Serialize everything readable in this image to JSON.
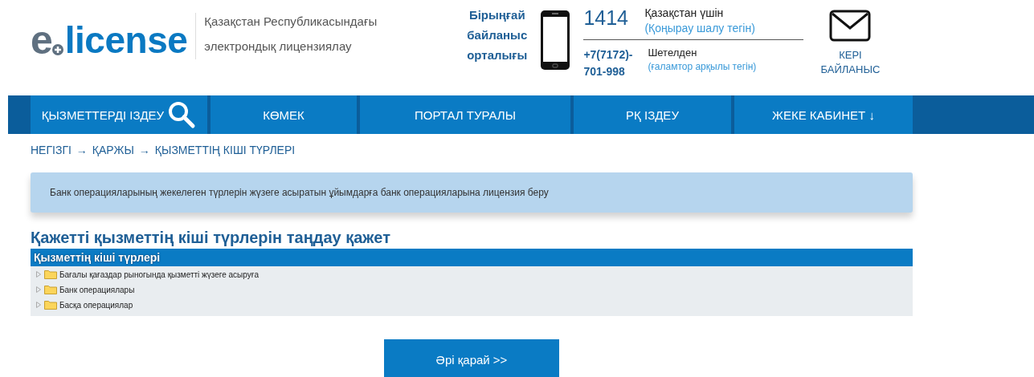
{
  "header": {
    "logo": {
      "letter": "e",
      "word": "license"
    },
    "tagline": [
      "Қазақстан Республикасындағы",
      "электрондық лицензиялау"
    ],
    "contact_center": [
      "Бірыңғай",
      "байланыс",
      "орталығы"
    ],
    "phones": [
      {
        "number": "1414",
        "region": "Қазақстан үшін",
        "note": "(Қоңырау шалу тегін)"
      },
      {
        "number": "+7(7172)-701-998",
        "region": "Шетелден",
        "note": "(ғаламтор арқылы тегін)"
      }
    ],
    "feedback": [
      "КЕРІ",
      "БАЙЛАНЫС"
    ]
  },
  "nav": [
    {
      "label": "ҚЫЗМЕТТЕРДІ ІЗДЕУ",
      "kind": "search"
    },
    {
      "label": "КӨМЕК",
      "kind": "link"
    },
    {
      "label": "ПОРТАЛ ТУРАЛЫ",
      "kind": "link"
    },
    {
      "label": "РҚ ІЗДЕУ",
      "kind": "link"
    },
    {
      "label": "ЖЕКЕ КАБИНЕТ ↓",
      "kind": "link"
    }
  ],
  "breadcrumb": [
    "НЕГІЗГІ",
    "→",
    "ҚАРЖЫ",
    "→",
    "ҚЫЗМЕТТІҢ КІШІ ТҮРЛЕРІ"
  ],
  "notice": "Банк операцияларының жекелеген түрлерін жүзеге асыратын ұйымдарға банк операцияларына лицензия беру",
  "heading": "Қажетті қызметтің кіші түрлерін таңдау қажет",
  "tree": {
    "title": "Қызметтің кіші түрлері",
    "items": [
      {
        "label": "Бағалы қағаздар рыногында қызметті жүзеге асыруға",
        "expanded": false
      },
      {
        "label": "Банк операциялары",
        "expanded": false
      },
      {
        "label": "Басқа операциялар",
        "expanded": false
      }
    ]
  },
  "next_button": "Әрі қарай >>"
}
